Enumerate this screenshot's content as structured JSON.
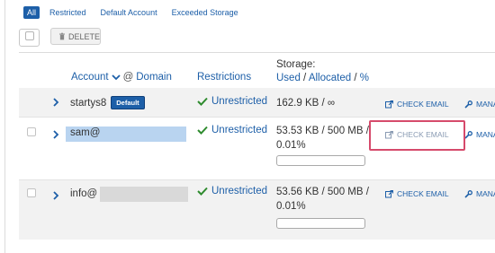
{
  "filters": {
    "all": "All",
    "restricted": "Restricted",
    "default_account": "Default Account",
    "exceeded_storage": "Exceeded Storage"
  },
  "toolbar": {
    "delete_label": "DELETE"
  },
  "header": {
    "account": "Account",
    "at": "@",
    "domain": "Domain",
    "restrictions": "Restrictions",
    "storage": "Storage:",
    "used": "Used",
    "sep1": " / ",
    "allocated": "Allocated",
    "sep2": " / ",
    "percent": "%"
  },
  "rows": [
    {
      "name": "startys8",
      "badge": "Default",
      "status": "Unrestricted",
      "usage": "162.9 KB / ∞",
      "usage_pct": "",
      "check_email": "CHECK EMAIL",
      "manage": "MANAG"
    },
    {
      "name": "sam@",
      "badge": "",
      "status": "Unrestricted",
      "usage": "53.53 KB / 500 MB /",
      "usage_pct": "0.01%",
      "check_email": "CHECK EMAIL",
      "manage": "MANAG"
    },
    {
      "name": "info@",
      "badge": "",
      "status": "Unrestricted",
      "usage": "53.56 KB / 500 MB /",
      "usage_pct": "0.01%",
      "check_email": "CHECK EMAIL",
      "manage": "MANAG"
    }
  ],
  "colors": {
    "link": "#1d5fa8",
    "highlight": "#d64a6b",
    "row_alt": "#f2f2f2"
  }
}
